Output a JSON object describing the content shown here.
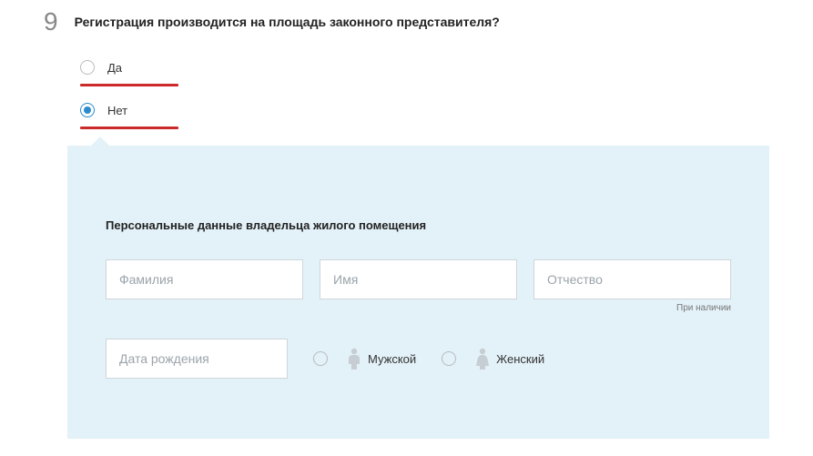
{
  "question": {
    "number": "9",
    "text": "Регистрация производится на площадь законного представителя?"
  },
  "options": {
    "yes": "Да",
    "no": "Нет"
  },
  "form": {
    "section_title": "Персональные данные владельца жилого помещения",
    "lastname_placeholder": "Фамилия",
    "firstname_placeholder": "Имя",
    "patronymic_placeholder": "Отчество",
    "patronymic_hint": "При наличии",
    "dob_placeholder": "Дата рождения",
    "gender_male": "Мужской",
    "gender_female": "Женский"
  }
}
